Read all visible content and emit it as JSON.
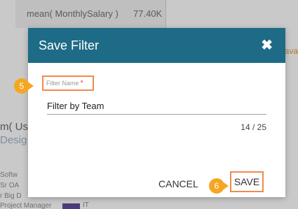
{
  "background": {
    "metric_label": "mean( MonthlySalary )",
    "metric_value": "77.40K",
    "right_fragment": "ava",
    "left_fragment_1": "m( Us",
    "left_fragment_2": "Desig",
    "left_small": [
      "Softw",
      "Sr OA",
      "r Big D",
      "Project Manager"
    ],
    "right_small": "IT"
  },
  "dialog": {
    "title": "Save Filter",
    "close_icon": "close-icon",
    "field": {
      "label": "Filter Name",
      "required_mark": "*",
      "value": "Filter by Team",
      "char_count": "14 / 25"
    },
    "cancel_label": "CANCEL",
    "save_label": "SAVE"
  },
  "steps": {
    "step_5": "5",
    "step_6": "6"
  },
  "colors": {
    "header": "#1d6b86",
    "highlight": "#f08a4b",
    "step_badge": "#f5a623"
  }
}
